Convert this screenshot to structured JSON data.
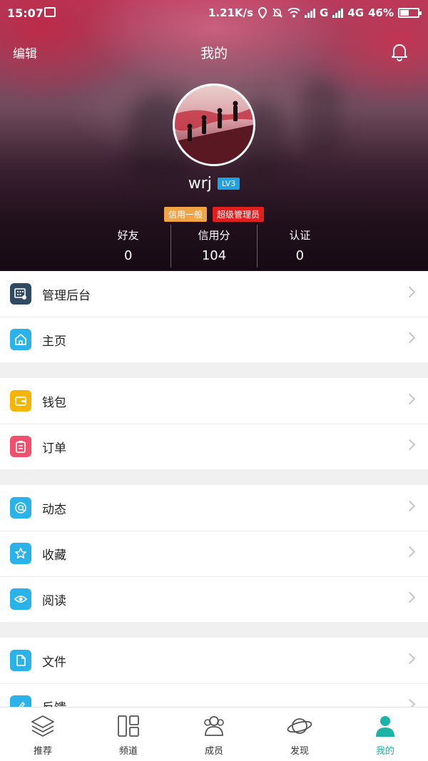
{
  "status_bar": {
    "time": "15:07",
    "net_speed": "1.21K/s",
    "network1": "G",
    "network2": "4G",
    "battery": "46%"
  },
  "header": {
    "edit_label": "编辑",
    "title": "我的",
    "bell_icon": "bell-icon"
  },
  "profile": {
    "username": "wrj",
    "level": "LV3",
    "tags": [
      "信用一般",
      "超级管理员"
    ],
    "stats": [
      {
        "label": "好友",
        "value": "0"
      },
      {
        "label": "信用分",
        "value": "104"
      },
      {
        "label": "认证",
        "value": "0"
      }
    ]
  },
  "menu_groups": [
    [
      {
        "label": "管理后台",
        "icon": "dashboard-icon",
        "color": "#2f4a62"
      },
      {
        "label": "主页",
        "icon": "home-icon",
        "color": "#2bb2e8"
      }
    ],
    [
      {
        "label": "钱包",
        "icon": "wallet-icon",
        "color": "#f4b400"
      },
      {
        "label": "订单",
        "icon": "order-icon",
        "color": "#f0506e"
      }
    ],
    [
      {
        "label": "动态",
        "icon": "at-icon",
        "color": "#2bb2e8"
      },
      {
        "label": "收藏",
        "icon": "star-icon",
        "color": "#2bb2e8"
      },
      {
        "label": "阅读",
        "icon": "eye-icon",
        "color": "#2bb2e8"
      }
    ],
    [
      {
        "label": "文件",
        "icon": "file-icon",
        "color": "#2bb2e8"
      },
      {
        "label": "反馈",
        "icon": "feedback-icon",
        "color": "#2bb2e8"
      }
    ]
  ],
  "tabbar": {
    "tabs": [
      {
        "label": "推荐",
        "icon": "layers-icon"
      },
      {
        "label": "频道",
        "icon": "channel-grid-icon"
      },
      {
        "label": "成员",
        "icon": "members-icon"
      },
      {
        "label": "发现",
        "icon": "planet-icon"
      },
      {
        "label": "我的",
        "icon": "person-icon",
        "active": true
      }
    ],
    "active_color": "#1cb3a6"
  }
}
